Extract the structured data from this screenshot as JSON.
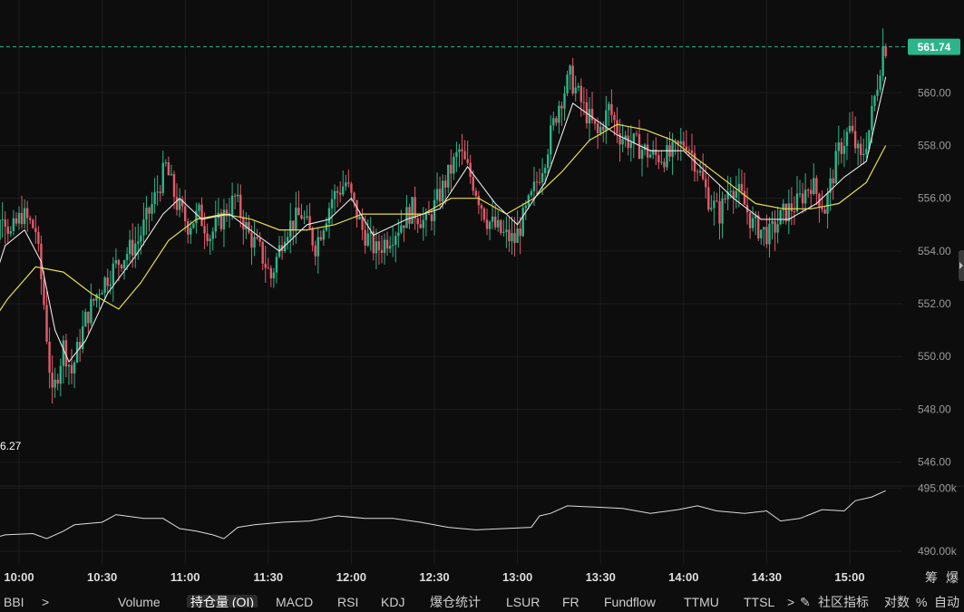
{
  "colors": {
    "background": "#0d0d0d",
    "up": "#2bb58a",
    "down": "#e45a6a",
    "ma_fast": "#e8e8e8",
    "ma_slow": "#e6dd4a",
    "oi_line": "#dcdcdc",
    "price_tag": "#2bb58a",
    "grid": "#1c1c1c"
  },
  "chart_data": [
    {
      "type": "candlestick",
      "last_price_label": "561.74",
      "low_marker_label": "6.27",
      "ylim": [
        545.3,
        563.0
      ],
      "y_ticks": [
        "560.00",
        "558.00",
        "556.00",
        "554.00",
        "552.00",
        "550.00",
        "548.00",
        "546.00"
      ],
      "y_tick_values": [
        560,
        558,
        556,
        554,
        552,
        550,
        548,
        546
      ],
      "x_ticks": [
        "10:00",
        "10:30",
        "11:00",
        "11:30",
        "12:00",
        "12:30",
        "13:00",
        "13:30",
        "14:00",
        "14:30",
        "15:00"
      ],
      "price_path": [
        [
          "09:47",
          551.8
        ],
        [
          "09:52",
          554.2
        ],
        [
          "09:55",
          555.6
        ],
        [
          "09:58",
          554.6
        ],
        [
          "10:02",
          555.4
        ],
        [
          "10:07",
          554.8
        ],
        [
          "10:10",
          552.0
        ],
        [
          "10:13",
          548.4
        ],
        [
          "10:17",
          550.4
        ],
        [
          "10:20",
          549.4
        ],
        [
          "10:25",
          551.4
        ],
        [
          "10:30",
          552.6
        ],
        [
          "10:37",
          553.6
        ],
        [
          "10:44",
          554.4
        ],
        [
          "10:50",
          556.0
        ],
        [
          "10:54",
          557.2
        ],
        [
          "10:58",
          555.8
        ],
        [
          "11:02",
          555.0
        ],
        [
          "11:06",
          555.4
        ],
        [
          "11:10",
          554.6
        ],
        [
          "11:14",
          555.2
        ],
        [
          "11:19",
          556.0
        ],
        [
          "11:24",
          554.6
        ],
        [
          "11:28",
          554.0
        ],
        [
          "11:32",
          553.0
        ],
        [
          "11:37",
          554.8
        ],
        [
          "11:43",
          555.4
        ],
        [
          "11:48",
          554.2
        ],
        [
          "11:54",
          556.0
        ],
        [
          "11:59",
          556.6
        ],
        [
          "12:05",
          554.8
        ],
        [
          "12:10",
          554.0
        ],
        [
          "12:17",
          554.8
        ],
        [
          "12:23",
          555.6
        ],
        [
          "12:28",
          555.0
        ],
        [
          "12:34",
          556.4
        ],
        [
          "12:40",
          557.8
        ],
        [
          "12:45",
          556.6
        ],
        [
          "12:50",
          555.2
        ],
        [
          "12:56",
          554.6
        ],
        [
          "13:00",
          554.4
        ],
        [
          "13:06",
          556.0
        ],
        [
          "13:11",
          557.6
        ],
        [
          "13:16",
          559.6
        ],
        [
          "13:20",
          560.6
        ],
        [
          "13:25",
          559.4
        ],
        [
          "13:30",
          558.4
        ],
        [
          "13:34",
          559.4
        ],
        [
          "13:38",
          558.4
        ],
        [
          "13:44",
          558.0
        ],
        [
          "13:50",
          557.6
        ],
        [
          "13:56",
          557.6
        ],
        [
          "14:02",
          558.2
        ],
        [
          "14:06",
          557.2
        ],
        [
          "14:10",
          556.0
        ],
        [
          "14:14",
          555.4
        ],
        [
          "14:18",
          556.6
        ],
        [
          "14:22",
          556.0
        ],
        [
          "14:26",
          555.0
        ],
        [
          "14:32",
          554.6
        ],
        [
          "14:37",
          555.4
        ],
        [
          "14:42",
          555.8
        ],
        [
          "14:47",
          556.6
        ],
        [
          "14:52",
          555.6
        ],
        [
          "14:57",
          557.8
        ],
        [
          "15:01",
          558.6
        ],
        [
          "15:05",
          557.4
        ],
        [
          "15:08",
          558.6
        ],
        [
          "15:11",
          560.4
        ],
        [
          "15:13",
          561.74
        ]
      ],
      "ma_fast_path": [
        [
          "09:47",
          551.6
        ],
        [
          "09:55",
          554.2
        ],
        [
          "10:02",
          554.8
        ],
        [
          "10:08",
          553.6
        ],
        [
          "10:13",
          551.0
        ],
        [
          "10:18",
          549.8
        ],
        [
          "10:24",
          550.6
        ],
        [
          "10:32",
          552.4
        ],
        [
          "10:42",
          553.8
        ],
        [
          "10:52",
          555.4
        ],
        [
          "10:58",
          556.0
        ],
        [
          "11:06",
          555.2
        ],
        [
          "11:16",
          555.4
        ],
        [
          "11:26",
          554.6
        ],
        [
          "11:34",
          554.0
        ],
        [
          "11:44",
          555.0
        ],
        [
          "11:52",
          555.2
        ],
        [
          "12:00",
          556.0
        ],
        [
          "12:08",
          554.6
        ],
        [
          "12:20",
          555.2
        ],
        [
          "12:32",
          555.6
        ],
        [
          "12:42",
          557.2
        ],
        [
          "12:52",
          555.8
        ],
        [
          "13:00",
          555.0
        ],
        [
          "13:10",
          556.6
        ],
        [
          "13:20",
          559.6
        ],
        [
          "13:28",
          559.0
        ],
        [
          "13:36",
          558.4
        ],
        [
          "13:48",
          557.8
        ],
        [
          "14:00",
          557.8
        ],
        [
          "14:10",
          556.8
        ],
        [
          "14:18",
          556.0
        ],
        [
          "14:28",
          555.2
        ],
        [
          "14:38",
          555.2
        ],
        [
          "14:48",
          555.8
        ],
        [
          "14:58",
          556.8
        ],
        [
          "15:06",
          557.4
        ],
        [
          "15:13",
          560.6
        ]
      ],
      "ma_slow_path": [
        [
          "09:47",
          550.8
        ],
        [
          "09:56",
          552.2
        ],
        [
          "10:06",
          553.4
        ],
        [
          "10:16",
          553.2
        ],
        [
          "10:26",
          552.4
        ],
        [
          "10:36",
          551.8
        ],
        [
          "10:44",
          552.8
        ],
        [
          "10:54",
          554.4
        ],
        [
          "11:04",
          555.2
        ],
        [
          "11:14",
          555.4
        ],
        [
          "11:24",
          555.2
        ],
        [
          "11:34",
          554.8
        ],
        [
          "11:44",
          554.8
        ],
        [
          "11:54",
          555.0
        ],
        [
          "12:04",
          555.4
        ],
        [
          "12:14",
          555.4
        ],
        [
          "12:26",
          555.4
        ],
        [
          "12:36",
          556.0
        ],
        [
          "12:46",
          556.0
        ],
        [
          "12:56",
          555.4
        ],
        [
          "13:06",
          556.0
        ],
        [
          "13:16",
          557.0
        ],
        [
          "13:26",
          558.2
        ],
        [
          "13:36",
          558.8
        ],
        [
          "13:46",
          558.6
        ],
        [
          "13:56",
          558.2
        ],
        [
          "14:06",
          557.4
        ],
        [
          "14:16",
          556.6
        ],
        [
          "14:26",
          555.8
        ],
        [
          "14:36",
          555.6
        ],
        [
          "14:46",
          555.6
        ],
        [
          "14:56",
          555.8
        ],
        [
          "15:06",
          556.6
        ],
        [
          "15:13",
          558.0
        ]
      ]
    },
    {
      "type": "line",
      "series_label": "Open Interest",
      "ylim": [
        489.0,
        495.6
      ],
      "y_ticks": [
        "495.00k",
        "490.00k"
      ],
      "y_tick_values": [
        495,
        490
      ],
      "oi_path": [
        [
          "09:45",
          489.6
        ],
        [
          "09:50",
          491.0
        ],
        [
          "09:55",
          491.3
        ],
        [
          "10:05",
          491.4
        ],
        [
          "10:10",
          491.0
        ],
        [
          "10:16",
          491.6
        ],
        [
          "10:20",
          492.1
        ],
        [
          "10:30",
          492.3
        ],
        [
          "10:35",
          492.9
        ],
        [
          "10:45",
          492.6
        ],
        [
          "10:52",
          492.6
        ],
        [
          "10:58",
          491.8
        ],
        [
          "11:04",
          491.6
        ],
        [
          "11:10",
          491.3
        ],
        [
          "11:14",
          491.0
        ],
        [
          "11:19",
          491.9
        ],
        [
          "11:25",
          492.1
        ],
        [
          "11:35",
          492.3
        ],
        [
          "11:45",
          492.4
        ],
        [
          "11:55",
          492.8
        ],
        [
          "12:05",
          492.6
        ],
        [
          "12:15",
          492.6
        ],
        [
          "12:25",
          492.3
        ],
        [
          "12:35",
          491.9
        ],
        [
          "12:45",
          491.7
        ],
        [
          "12:55",
          491.8
        ],
        [
          "13:05",
          491.9
        ],
        [
          "13:08",
          492.8
        ],
        [
          "13:12",
          493.0
        ],
        [
          "13:18",
          493.6
        ],
        [
          "13:28",
          493.5
        ],
        [
          "13:38",
          493.4
        ],
        [
          "13:48",
          493.0
        ],
        [
          "13:58",
          493.3
        ],
        [
          "14:05",
          493.6
        ],
        [
          "14:12",
          493.2
        ],
        [
          "14:22",
          493.0
        ],
        [
          "14:30",
          493.2
        ],
        [
          "14:35",
          492.4
        ],
        [
          "14:42",
          492.6
        ],
        [
          "14:50",
          493.3
        ],
        [
          "14:58",
          493.2
        ],
        [
          "15:02",
          494.0
        ],
        [
          "15:08",
          494.3
        ],
        [
          "15:13",
          494.8
        ]
      ]
    }
  ],
  "toolbar": {
    "items": [
      "BBI",
      ">",
      "Volume",
      "持仓量 (OI)",
      "MACD",
      "RSI",
      "KDJ",
      "爆仓统计",
      "LSUR",
      "FR",
      "Fundflow",
      "TTMU",
      "TTSL",
      ">",
      "社区指标",
      "对数",
      "%",
      "自动"
    ],
    "active": "持仓量 (OI)"
  },
  "right_labels": {
    "top": "筹",
    "second": "爆"
  },
  "icons": {
    "edit": "pencil-icon",
    "side_handle": "chevron-left-icon"
  }
}
